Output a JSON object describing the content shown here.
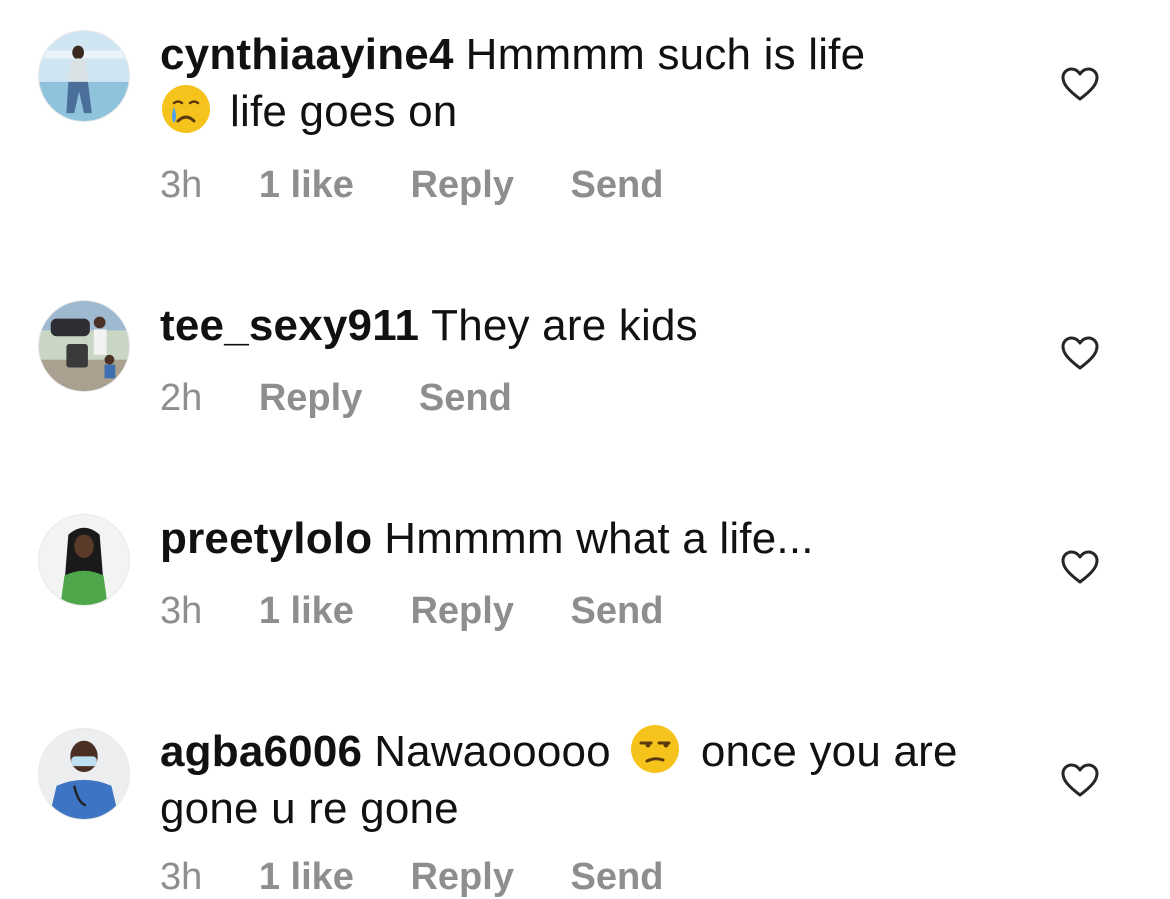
{
  "comments": [
    {
      "username": "cynthiaayine4",
      "text_before_emoji": "Hmmmm such is life",
      "emoji": "crying-face-emoji",
      "text_after_emoji": "life goes on",
      "time": "3h",
      "likes": "1 like",
      "reply": "Reply",
      "send": "Send",
      "avatar": "cynthiaayine4-avatar"
    },
    {
      "username": "tee_sexy911",
      "text": "They are kids",
      "time": "2h",
      "reply": "Reply",
      "send": "Send",
      "avatar": "tee_sexy911-avatar"
    },
    {
      "username": "preetylolo",
      "text": "Hmmmm what a life...",
      "time": "3h",
      "likes": "1 like",
      "reply": "Reply",
      "send": "Send",
      "avatar": "preetylolo-avatar"
    },
    {
      "username": "agba6006",
      "text_before_emoji": "Nawaooooo",
      "emoji": "unamused-face-emoji",
      "text_after_emoji": "once you are gone u re gone",
      "time": "3h",
      "likes": "1 like",
      "reply": "Reply",
      "send": "Send",
      "avatar": "agba6006-avatar"
    }
  ],
  "colors": {
    "text": "#111111",
    "meta": "#8e8e8e",
    "emoji_yellow": "#f6c21c"
  }
}
